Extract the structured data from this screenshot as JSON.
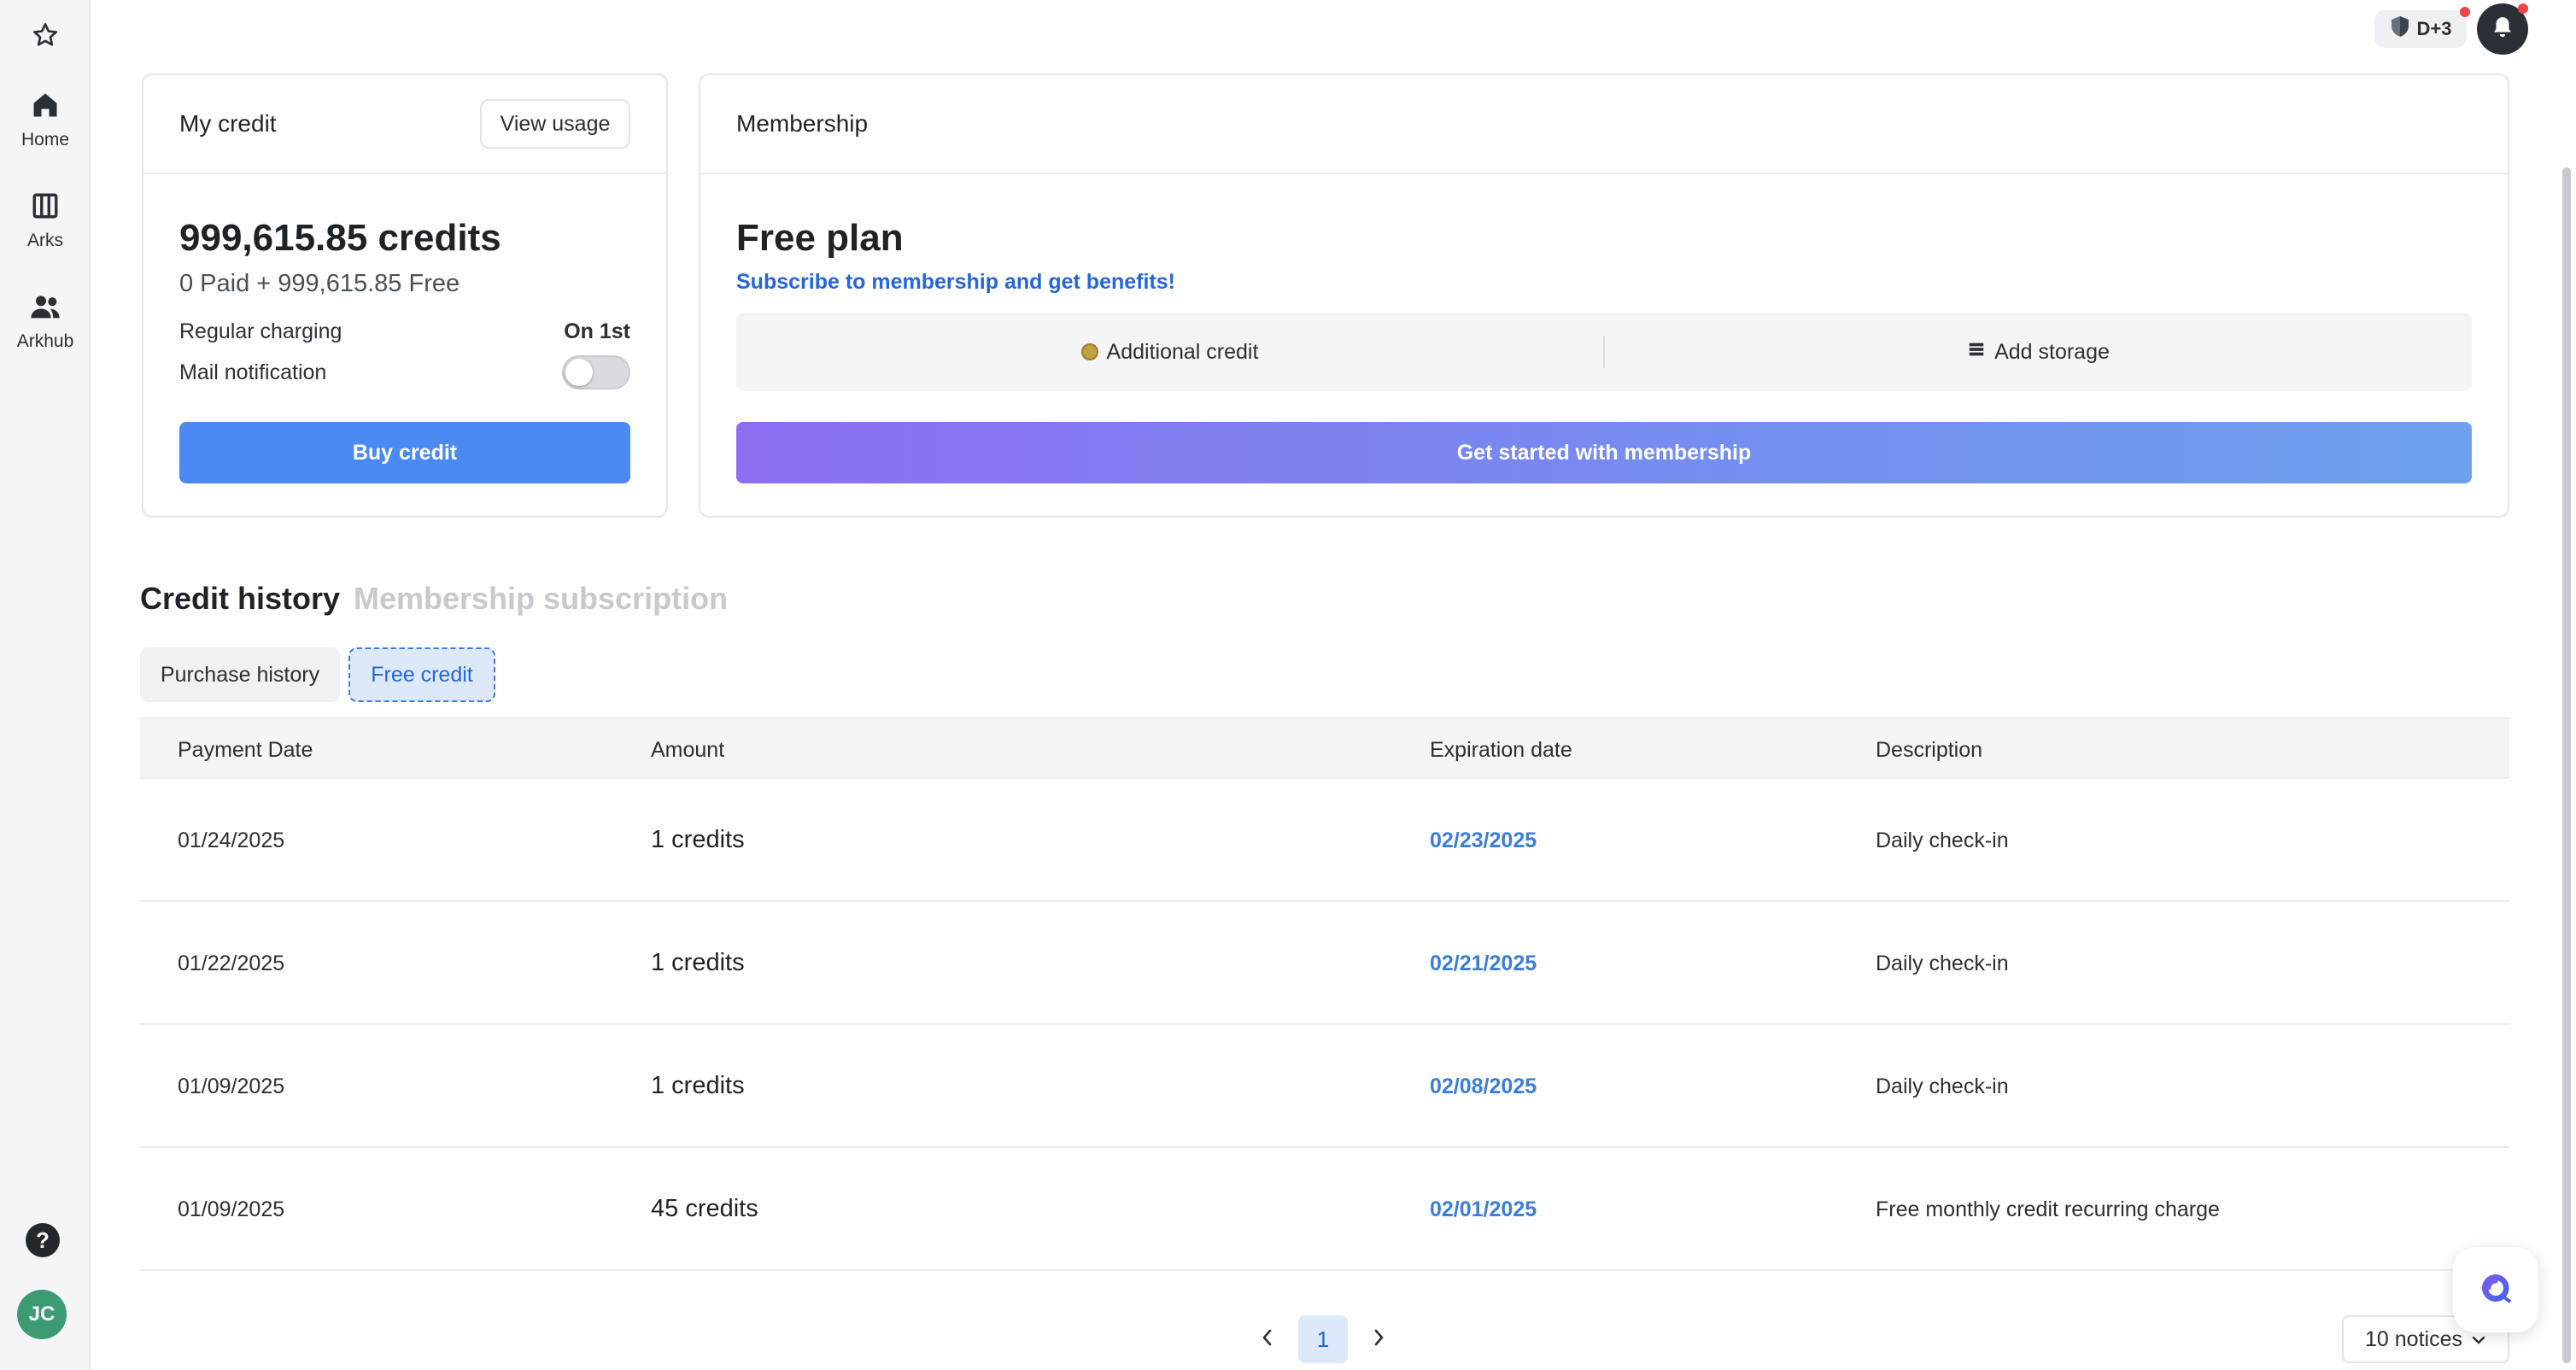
{
  "sidebar": {
    "items": [
      {
        "label": "Home",
        "icon": "home-icon"
      },
      {
        "label": "Arks",
        "icon": "columns-icon"
      },
      {
        "label": "Arkhub",
        "icon": "people-icon"
      }
    ],
    "help_glyph": "?",
    "avatar_initials": "JC"
  },
  "topbar": {
    "badge_label": "D+3"
  },
  "my_credit": {
    "title": "My credit",
    "view_usage_label": "View usage",
    "balance": "999,615.85 credits",
    "breakdown": "0 Paid + 999,615.85 Free",
    "regular_charging_label": "Regular charging",
    "regular_charging_value": "On 1st",
    "mail_notification_label": "Mail notification",
    "mail_notification_on": false,
    "buy_label": "Buy credit"
  },
  "membership": {
    "title": "Membership",
    "plan": "Free plan",
    "subscribe_link": "Subscribe to membership and get benefits!",
    "benefits": [
      "Additional credit",
      "Add storage"
    ],
    "cta_label": "Get started with membership"
  },
  "history": {
    "tabs": [
      "Credit history",
      "Membership subscription"
    ],
    "active_tab": "Credit history",
    "subtabs": [
      "Purchase history",
      "Free credit"
    ],
    "active_subtab": "Free credit",
    "columns": [
      "Payment Date",
      "Amount",
      "Expiration date",
      "Description"
    ],
    "rows": [
      {
        "date": "01/24/2025",
        "amount": "1 credits",
        "expiration": "02/23/2025",
        "description": "Daily check-in"
      },
      {
        "date": "01/22/2025",
        "amount": "1 credits",
        "expiration": "02/21/2025",
        "description": "Daily check-in"
      },
      {
        "date": "01/09/2025",
        "amount": "1 credits",
        "expiration": "02/08/2025",
        "description": "Daily check-in"
      },
      {
        "date": "01/09/2025",
        "amount": "45 credits",
        "expiration": "02/01/2025",
        "description": "Free monthly credit recurring charge"
      }
    ]
  },
  "pagination": {
    "current_page": "1",
    "page_size_label": "10 notices"
  },
  "colors": {
    "primary": "#4b8af2",
    "link": "#2566d9",
    "gradient_start": "#8d6ef2",
    "gradient_end": "#6ea0ee"
  }
}
